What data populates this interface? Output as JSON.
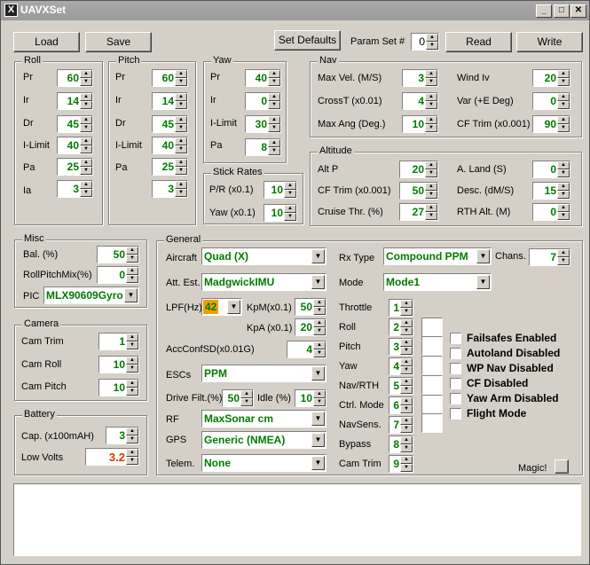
{
  "app": {
    "title": "UAVXSet"
  },
  "toolbar": {
    "load": "Load",
    "save": "Save",
    "set_defaults": "Set Defaults",
    "param_set_label": "Param Set #",
    "param_set_value": "0",
    "read": "Read",
    "write": "Write"
  },
  "roll": {
    "title": "Roll",
    "pr_label": "Pr",
    "pr": "60",
    "ir_label": "Ir",
    "ir": "14",
    "dr_label": "Dr",
    "dr": "45",
    "ilimit_label": "I-Limit",
    "ilimit": "40",
    "pa_label": "Pa",
    "pa": "25",
    "ia_label": "Ia",
    "ia": "3"
  },
  "pitch": {
    "title": "Pitch",
    "pr_label": "Pr",
    "pr": "60",
    "ir_label": "Ir",
    "ir": "14",
    "dr_label": "Dr",
    "dr": "45",
    "ilimit_label": "I-Limit",
    "ilimit": "40",
    "pa_label": "Pa",
    "pa": "25",
    "ia": "3"
  },
  "yaw": {
    "title": "Yaw",
    "pr_label": "Pr",
    "pr": "40",
    "ir_label": "Ir",
    "ir": "0",
    "ilimit_label": "I-Limit",
    "ilimit": "30",
    "pa_label": "Pa",
    "pa": "8"
  },
  "stick_rates": {
    "title": "Stick Rates",
    "pr_label": "P/R (x0.1)",
    "pr": "10",
    "yaw_label": "Yaw (x0.1)",
    "yaw": "10"
  },
  "nav": {
    "title": "Nav",
    "max_vel_label": "Max Vel. (M/S)",
    "max_vel": "3",
    "cross_label": "CrossT (x0.01)",
    "cross": "4",
    "max_ang_label": "Max Ang (Deg.)",
    "max_ang": "10",
    "wind_label": "Wind Iv",
    "wind": "20",
    "var_label": "Var (+E Deg)",
    "var": "0",
    "cf_trim_label": "CF Trim (x0.001)",
    "cf_trim": "90"
  },
  "altitude": {
    "title": "Altitude",
    "alt_p_label": "Alt P",
    "alt_p": "20",
    "cf_trim_label": "CF Trim (x0.001)",
    "cf_trim": "50",
    "cruise_label": "Cruise Thr. (%)",
    "cruise": "27",
    "aland_label": "A. Land (S)",
    "aland": "0",
    "desc_label": "Desc. (dM/S)",
    "desc": "15",
    "rth_label": "RTH Alt. (M)",
    "rth": "0"
  },
  "misc": {
    "title": "Misc",
    "bal_label": "Bal. (%)",
    "bal": "50",
    "rpm_label": "RollPitchMix(%)",
    "rpm": "0",
    "pic_label": "PIC",
    "pic": "MLX90609Gyro"
  },
  "camera": {
    "title": "Camera",
    "trim_label": "Cam Trim",
    "trim": "1",
    "roll_label": "Cam Roll",
    "roll": "10",
    "pitch_label": "Cam Pitch",
    "pitch": "10"
  },
  "battery": {
    "title": "Battery",
    "cap_label": "Cap. (x100mAH)",
    "cap": "3",
    "low_label": "Low Volts",
    "low": "3.2"
  },
  "general": {
    "title": "General",
    "aircraft_label": "Aircraft",
    "aircraft": "Quad (X)",
    "att_label": "Att. Est.",
    "att": "MadgwickIMU",
    "lpf_label": "LPF(Hz)",
    "lpf": "42",
    "kpm_label": "KpM(x0.1)",
    "kpm": "50",
    "kpa_label": "KpA (x0.1)",
    "kpa": "20",
    "acc_label": "AccConfSD(x0.01G)",
    "acc": "4",
    "escs_label": "ESCs",
    "escs": "PPM",
    "drive_label": "Drive Filt.(%)",
    "drive": "50",
    "idle_label": "Idle (%)",
    "idle": "10",
    "rf_label": "RF",
    "rf": "MaxSonar cm",
    "gps_label": "GPS",
    "gps": "Generic (NMEA)",
    "telem_label": "Telem.",
    "telem": "None",
    "rx_label": "Rx Type",
    "rx": "Compound PPM",
    "chans_label": "Chans.",
    "chans": "7",
    "mode_label": "Mode",
    "mode": "Mode1",
    "channels": [
      {
        "label": "Throttle",
        "value": "1"
      },
      {
        "label": "Roll",
        "value": "2"
      },
      {
        "label": "Pitch",
        "value": "3"
      },
      {
        "label": "Yaw",
        "value": "4"
      },
      {
        "label": "Nav/RTH",
        "value": "5"
      },
      {
        "label": "Ctrl. Mode",
        "value": "6"
      },
      {
        "label": "NavSens.",
        "value": "7"
      },
      {
        "label": "Bypass",
        "value": "8"
      },
      {
        "label": "Cam Trim",
        "value": "9"
      }
    ],
    "flags": [
      "Failsafes Enabled",
      "Autoland Disabled",
      "WP Nav Disabled",
      "CF Disabled",
      "Yaw Arm Disabled",
      "Flight Mode"
    ],
    "magic_label": "Magic!"
  },
  "colors": {
    "value_green": "#007a00",
    "battery_red": "#d04000",
    "lpf_highlight": "#f0a000"
  }
}
